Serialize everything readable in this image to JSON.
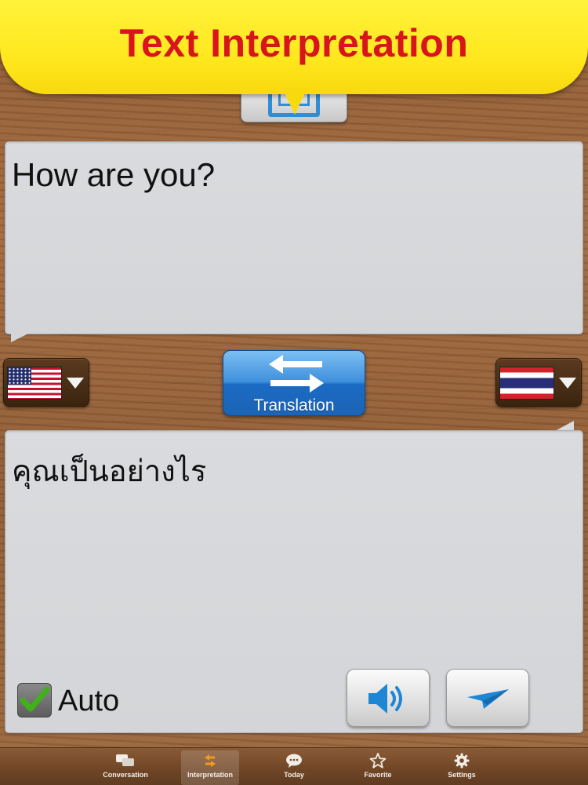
{
  "banner": {
    "title": "Text Interpretation"
  },
  "source": {
    "text": "How are you?"
  },
  "result": {
    "text": "คุณเป็นอย่างไร"
  },
  "languages": {
    "source": {
      "flag": "us-flag-icon"
    },
    "target": {
      "flag": "thailand-flag-icon"
    }
  },
  "translate_button": {
    "label": "Translation"
  },
  "auto": {
    "label": "Auto",
    "checked": true
  },
  "actions": {
    "speak_icon": "speaker-icon",
    "send_icon": "paper-plane-icon"
  },
  "tabs": [
    {
      "label": "Conversation",
      "icon": "chat-bubbles-icon",
      "active": false
    },
    {
      "label": "Interpretation",
      "icon": "swap-arrows-icon",
      "active": true
    },
    {
      "label": "Today",
      "icon": "speech-bubble-icon",
      "active": false
    },
    {
      "label": "Favorite",
      "icon": "star-icon",
      "active": false
    },
    {
      "label": "Settings",
      "icon": "gear-icon",
      "active": false
    }
  ],
  "colors": {
    "banner": "#ffe81f",
    "title": "#d8141c",
    "accent_blue": "#1c64b5",
    "check_green": "#3fb21b"
  }
}
